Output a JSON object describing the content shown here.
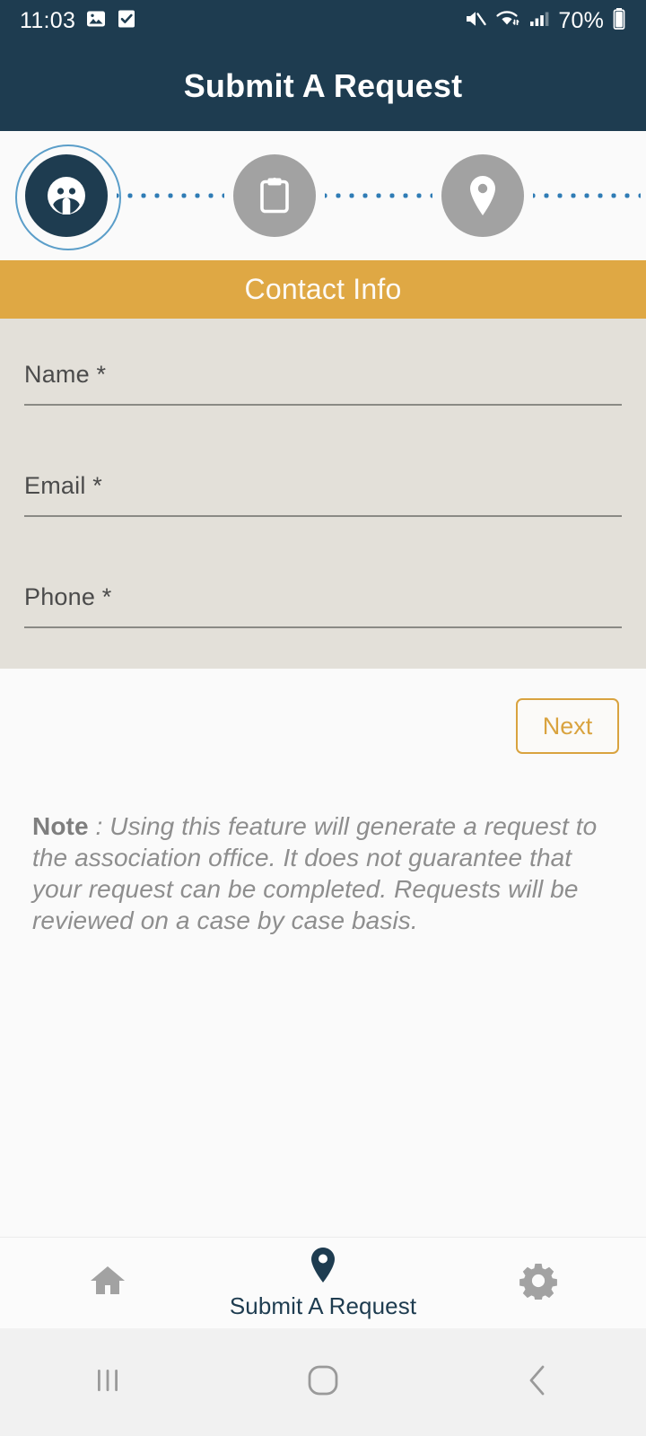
{
  "status_bar": {
    "time": "11:03",
    "battery_percent": "70%",
    "left_icons": [
      "image-icon",
      "checkbox-icon"
    ],
    "right_icons": [
      "mute-icon",
      "wifi-icon",
      "signal-icon",
      "battery-icon"
    ],
    "background_color": "#1e3c50"
  },
  "app_bar": {
    "title": "Submit A Request",
    "background_color": "#1e3c50",
    "title_color": "#ffffff"
  },
  "stepper": {
    "active_index": 0,
    "active_color": "#1e3c50",
    "inactive_color": "#a2a2a2",
    "ring_color": "#5b9ec9",
    "connector_color": "#2f7cb5",
    "steps": [
      {
        "icon": "contacts-icon",
        "name": "contact-info",
        "state": "active"
      },
      {
        "icon": "clipboard-icon",
        "name": "request-details",
        "state": "inactive"
      },
      {
        "icon": "location-pin-icon",
        "name": "location",
        "state": "inactive"
      },
      {
        "icon": "camera-icon",
        "name": "photos",
        "state": "inactive"
      }
    ]
  },
  "section": {
    "title": "Contact Info",
    "background_color": "#dfa844",
    "text_color": "#fdfaf5"
  },
  "form": {
    "background_color": "#e3e0d9",
    "fields": [
      {
        "label": "Name *",
        "value": "",
        "placeholder": "Name *",
        "name": "name-field"
      },
      {
        "label": "Email *",
        "value": "",
        "placeholder": "Email *",
        "name": "email-field"
      },
      {
        "label": "Phone *",
        "value": "",
        "placeholder": "Phone *",
        "name": "phone-field"
      }
    ]
  },
  "actions": {
    "next_label": "Next",
    "next_color": "#d9a33f"
  },
  "note": {
    "prefix": "Note",
    "separator": " : ",
    "body": "Using this feature will generate a request to the association office.  It does not guarantee that your request can be completed. Requests will be reviewed on a case by case basis.",
    "text_color": "#8e8e8e"
  },
  "tab_bar": {
    "active_index": 1,
    "active_color": "#1e3c50",
    "inactive_color": "#a2a2a2",
    "tabs": [
      {
        "icon": "home-icon",
        "label": "",
        "name": "tab-home",
        "state": "inactive"
      },
      {
        "icon": "location-pin-icon",
        "label": "Submit A Request",
        "name": "tab-submit-a-request",
        "state": "active"
      },
      {
        "icon": "gear-icon",
        "label": "",
        "name": "tab-settings",
        "state": "inactive"
      }
    ]
  },
  "system_nav": {
    "buttons": [
      {
        "icon": "recent-apps-icon",
        "name": "recent-apps-button"
      },
      {
        "icon": "home-circle-icon",
        "name": "home-button"
      },
      {
        "icon": "back-chevron-icon",
        "name": "back-button"
      }
    ],
    "background_color": "#f1f1f1"
  }
}
